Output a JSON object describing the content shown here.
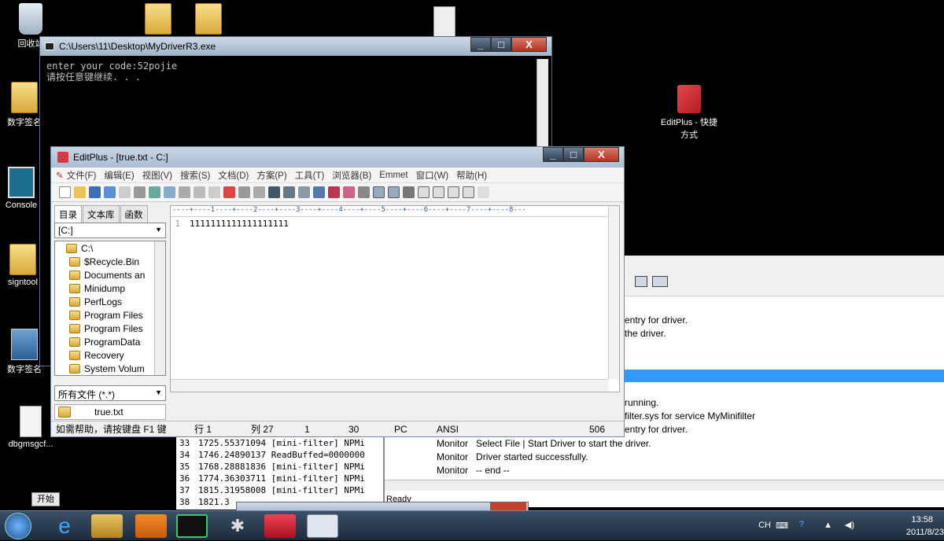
{
  "desktop": {
    "icons": [
      {
        "label": "回收站",
        "icon": "recycle-bin-icon"
      },
      {
        "label": "数字签名",
        "icon": "folder-icon"
      },
      {
        "label": "Console",
        "icon": "console-icon"
      },
      {
        "label": "signtool",
        "icon": "folder-icon"
      },
      {
        "label": "数字签名",
        "icon": "shortcut-icon"
      },
      {
        "label": "dbgmsgcf...",
        "icon": "gear-file-icon"
      },
      {
        "label": "EditPlus - 快捷方式",
        "icon": "editplus-shortcut-icon"
      }
    ],
    "start_label": "开始"
  },
  "console": {
    "title": "C:\\Users\\11\\Desktop\\MyDriverR3.exe",
    "line1": "enter your code:52pojie",
    "line2": "请按任意键继续. . ."
  },
  "editplus": {
    "title": "EditPlus - [true.txt - C:]",
    "menu": [
      "文件(F)",
      "编辑(E)",
      "视图(V)",
      "搜索(S)",
      "文档(D)",
      "方案(P)",
      "工具(T)",
      "浏览器(B)",
      "Emmet",
      "窗口(W)",
      "帮助(H)"
    ],
    "tabs": [
      "目录",
      "文本库",
      "函数"
    ],
    "drive": "[C:]",
    "tree": [
      "C:\\",
      "$Recycle.Bin",
      "Documents an",
      "Minidump",
      "PerfLogs",
      "Program Files",
      "Program Files",
      "ProgramData",
      "Recovery",
      "System Volum"
    ],
    "filter": "所有文件 (*.*)",
    "ruler": "----+----1----+----2----+----3----+----4----+----5----+----6----+----7----+----8---",
    "line_no": "1",
    "content": "1111111111111111111",
    "file_tab": "true.txt",
    "status": {
      "help": "如需帮助，请按键盘 F1 键",
      "line": "行 1",
      "col": "列 27",
      "v1": "1",
      "v2": "30",
      "mode": "PC",
      "enc": "ANSI",
      "size": "506"
    }
  },
  "debugview": {
    "rows": [
      {
        "text": "entry for driver."
      },
      {
        "text": "the driver."
      },
      {
        "text": "running."
      },
      {
        "text": "filter.sys for service MyMinifilter"
      },
      {
        "text": "entry for driver."
      }
    ],
    "monitor": [
      {
        "src": "Monitor",
        "msg": "Select File | Start Driver to start the driver."
      },
      {
        "src": "Monitor",
        "msg": "Driver started successfully."
      },
      {
        "src": "Monitor",
        "msg": "-- end --"
      }
    ],
    "ready": "Ready"
  },
  "dbglist": {
    "rows": [
      {
        "n": "33",
        "text": "1725.55371094  [mini-filter] NPMi"
      },
      {
        "n": "34",
        "text": "1746.24890137  ReadBuffed=0000000"
      },
      {
        "n": "35",
        "text": "1768.28881836  [mini-filter] NPMi"
      },
      {
        "n": "36",
        "text": "1774.36303711  [mini-filter] NPMi"
      },
      {
        "n": "37",
        "text": "1815.31958008  [mini-filter] NPMi"
      },
      {
        "n": "38",
        "text": "1821.3"
      }
    ]
  },
  "taskbar": {
    "lang": "CH",
    "time": "13:58",
    "date": "2011/8/23"
  }
}
